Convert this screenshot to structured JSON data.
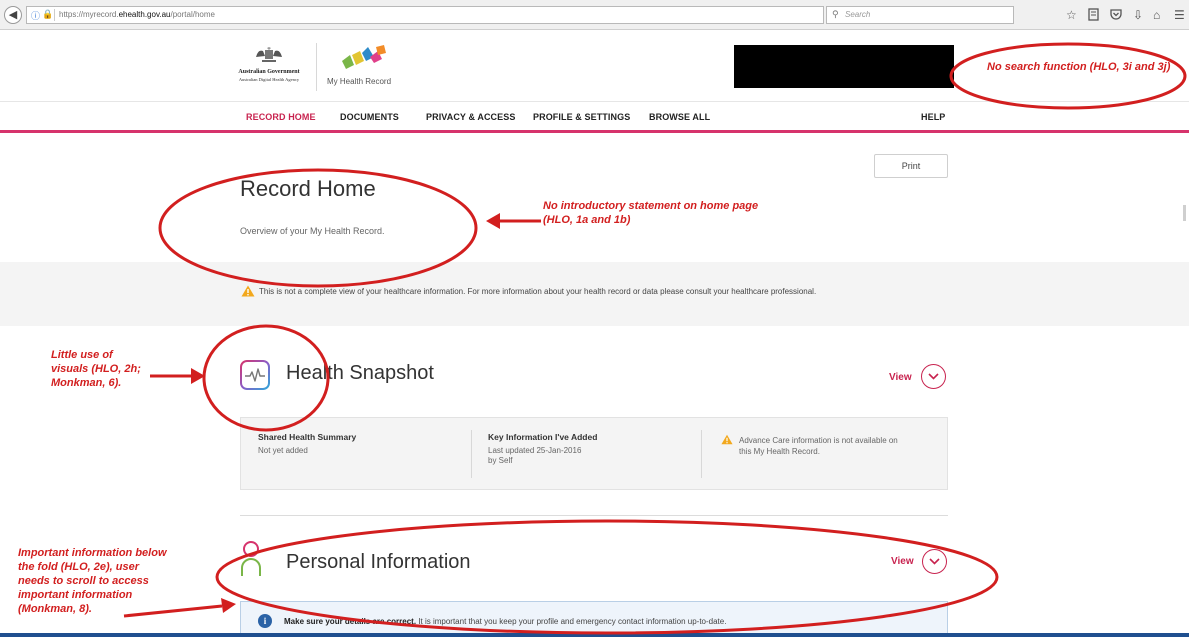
{
  "browser": {
    "url_prefix": "https://myrecord.",
    "url_domain": "ehealth.gov.au",
    "url_path": "/portal/home",
    "search_placeholder": "Search"
  },
  "header": {
    "gov_line1": "Australian Government",
    "gov_line2": "Australian Digital Health Agency",
    "product_name": "My Health Record"
  },
  "nav": {
    "items": [
      "RECORD HOME",
      "DOCUMENTS",
      "PRIVACY & ACCESS",
      "PROFILE & SETTINGS",
      "BROWSE ALL"
    ],
    "active": "RECORD HOME",
    "help": "HELP"
  },
  "page": {
    "print_label": "Print",
    "title": "Record Home",
    "subtitle": "Overview of your My Health Record.",
    "notice": "This is not a complete view of your healthcare information. For more information about your health record or data please consult your healthcare professional."
  },
  "health_snapshot": {
    "title": "Health Snapshot",
    "view_label": "View",
    "shared_summary_title": "Shared Health Summary",
    "shared_summary_value": "Not yet added",
    "key_info_title": "Key Information I've Added",
    "key_info_line1": "Last updated 25-Jan-2016",
    "key_info_line2": "by Self",
    "advance_care_line1": "Advance Care information is not available on",
    "advance_care_line2": "this My Health Record."
  },
  "personal_info": {
    "title": "Personal Information",
    "view_label": "View",
    "info_bold": "Make sure your details are correct.",
    "info_text": " It is important that you keep your profile and emergency contact information up-to-date."
  },
  "annotations": {
    "search": "No search function (HLO, 3i and 3j)",
    "intro": "No introductory statement on home page (HLO, 1a and 1b)",
    "visuals": "Little use of visuals (HLO, 2h; Monkman, 6).",
    "fold": "Important information below the fold (HLO, 2e), user needs to scroll to access important information (Monkman, 8)."
  },
  "colors": {
    "accent": "#c8234f",
    "annotation": "#d21f1f",
    "info_blue": "#2a62a6"
  }
}
